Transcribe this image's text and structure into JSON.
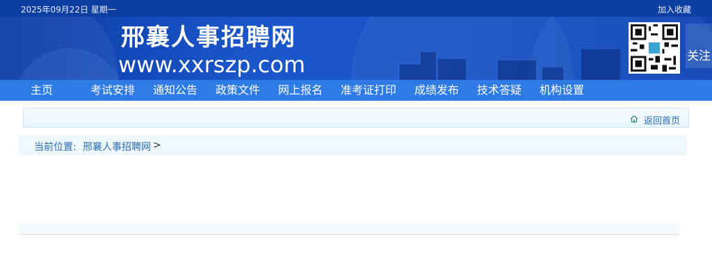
{
  "topbar": {
    "date": "2025年09月22日 星期一",
    "favorite": "加入收藏"
  },
  "header": {
    "title": "邢襄人事招聘网",
    "url": "www.xxrszp.com",
    "follow": "关注",
    "qr_icon": "qr-code-icon"
  },
  "nav": {
    "items": [
      "主页",
      "考试安排",
      "通知公告",
      "政策文件",
      "网上报名",
      "准考证打印",
      "成绩发布",
      "技术答疑",
      "机构设置"
    ]
  },
  "panel": {
    "back_home": "返回首页",
    "icon": "home-icon"
  },
  "breadcrumb": {
    "label": "当前位置:",
    "site": "邢襄人事招聘网",
    "sep": ">"
  },
  "colors": {
    "topbar": "#0d3fa3",
    "banner": "#1a56c9",
    "nav": "#2f7be6",
    "link": "#2a6db5"
  }
}
